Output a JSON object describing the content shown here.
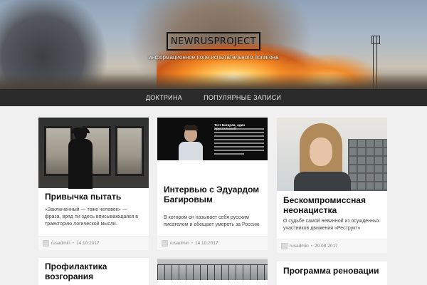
{
  "site": {
    "title": "NEWRUSPROJECT",
    "tagline": "информационное поле испытательного полигона"
  },
  "nav": {
    "items": [
      {
        "label": "ДОКТРИНА"
      },
      {
        "label": "ПОПУЛЯРНЫЕ ЗАПИСИ"
      }
    ]
  },
  "posts": [
    {
      "title": "Привычка пытать",
      "excerpt": "«Заключенный — тоже человек» — фраза, вряд ли здесь вписывающаяся в траекторию логической мысли.",
      "author": "rusadmin",
      "date": "14.10.2017"
    },
    {
      "title": "Интервью с Эдуардом Багировым",
      "excerpt": "В котором он называет себя русским писателем и обещает умереть за Россию",
      "author": "rusadmin",
      "date": "14.10.2017",
      "image_caption": "Тест Багиров, один Хрустальный:"
    },
    {
      "title": "Бескомпромиссная неонацистка",
      "excerpt": "О судьбе самой невинной из осужденных участников движения «Реструкт»",
      "author": "rusadmin",
      "date": "29.08.2017"
    },
    {
      "title": "Профилактика возгорания"
    },
    {
      "title": ""
    },
    {
      "title": "Программа реновации"
    }
  ],
  "colors": {
    "nav_bg": "#2b2b2b",
    "page_bg": "#f0f0f0",
    "card_bg": "#ffffff"
  },
  "icons": {
    "author_avatar": "avatar-placeholder-icon"
  }
}
